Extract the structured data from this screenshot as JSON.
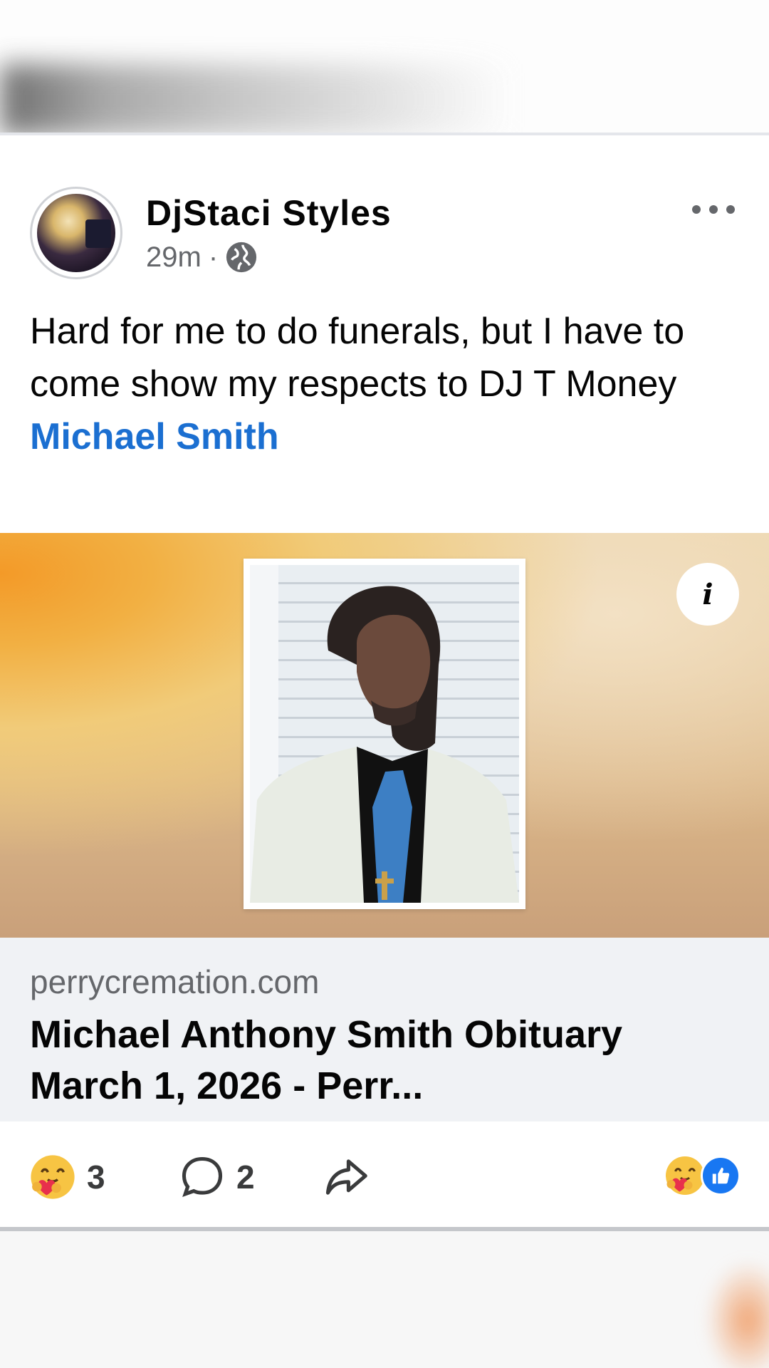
{
  "post": {
    "author": "DjStaci Styles",
    "time": "29m",
    "separator": "·",
    "text_line": "Hard for me to do funerals, but I have to come show my respects to DJ T Money",
    "mention": "Michael Smith"
  },
  "link_preview": {
    "domain": "perrycremation.com",
    "title": "Michael Anthony Smith Obituary March 1, 2026 - Perr...",
    "info_label": "i"
  },
  "footer": {
    "reaction_count": "3",
    "comment_count": "2"
  },
  "colors": {
    "link_blue": "#1b6fd1",
    "like_blue": "#1877f2",
    "muted_text": "#65676b"
  }
}
